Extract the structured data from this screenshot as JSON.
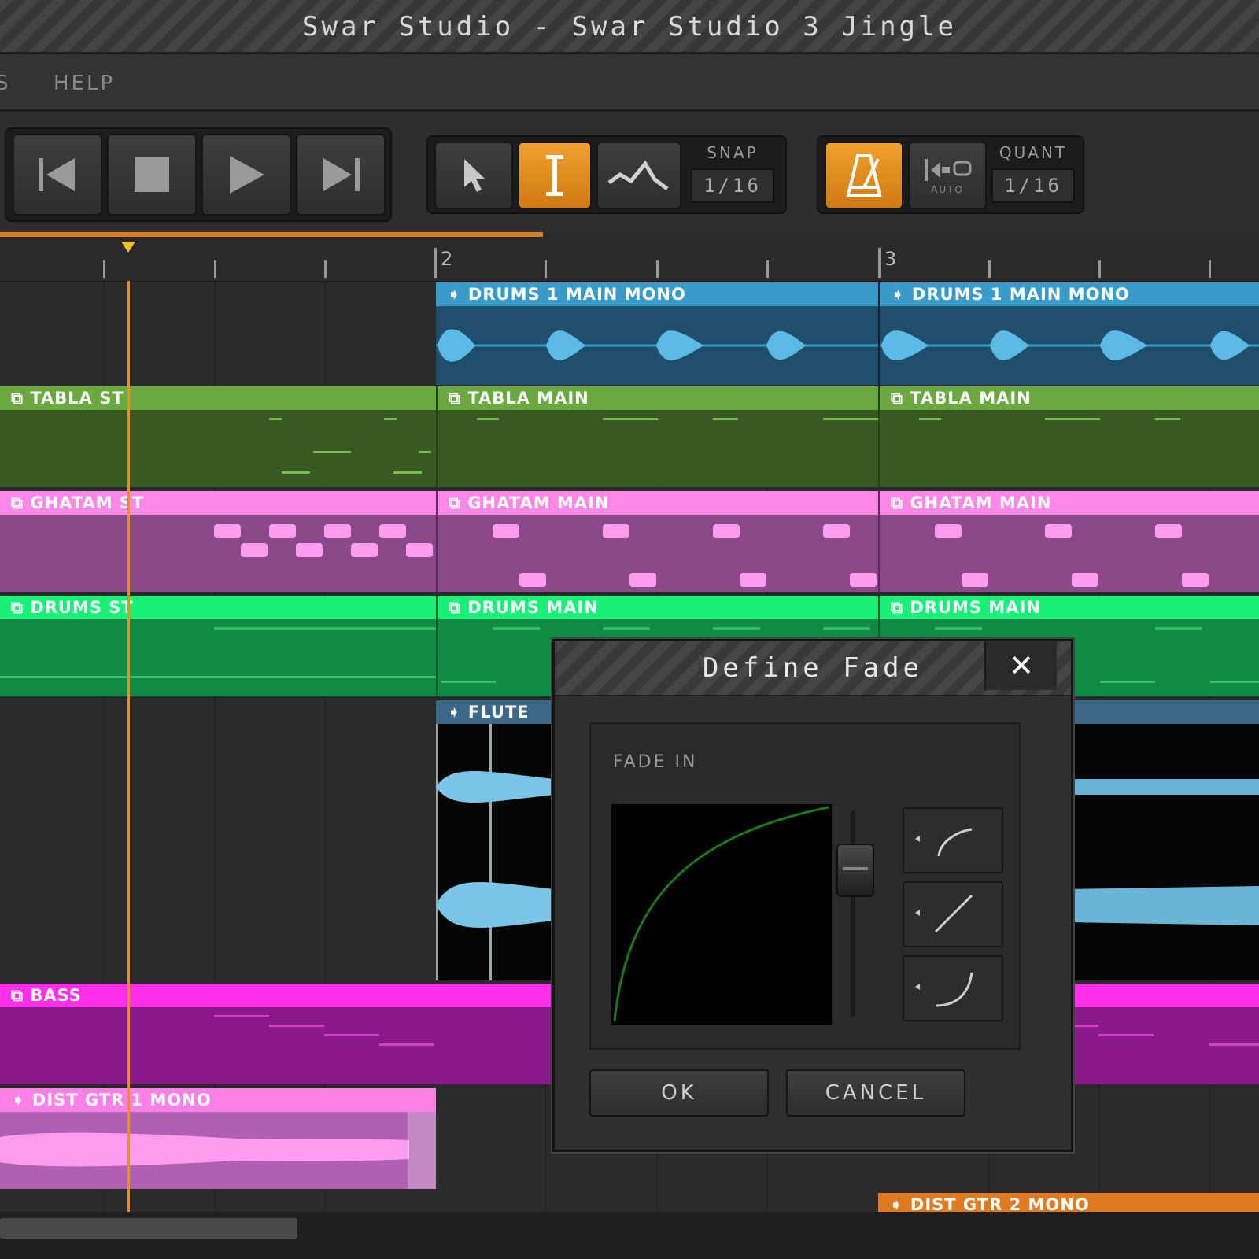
{
  "window": {
    "title": "Swar Studio - Swar Studio 3 Jingle"
  },
  "menu": {
    "partial": "S",
    "help": "HELP"
  },
  "transport": {
    "snap_label": "SNAP",
    "snap_value": "1/16",
    "quant_label": "QUANT",
    "quant_value": "1/16",
    "auto_label": "AUTO"
  },
  "ruler": {
    "bar2": "2",
    "bar3": "3"
  },
  "tracks": {
    "drums1_a": "DRUMS 1 MAIN MONO",
    "drums1_b": "DRUMS 1 MAIN MONO",
    "tabla_st": "TABLA ST",
    "tabla_main_a": "TABLA MAIN",
    "tabla_main_b": "TABLA MAIN",
    "ghatam_st": "GHATAM ST",
    "ghatam_main_a": "GHATAM MAIN",
    "ghatam_main_b": "GHATAM MAIN",
    "drums_st": "DRUMS ST",
    "drums_main_a": "DRUMS MAIN",
    "drums_main_b": "DRUMS MAIN",
    "flute": "FLUTE",
    "bass": "BASS",
    "dist_gtr1": "DIST GTR 1 MONO",
    "dist_gtr2": "DIST GTR 2 MONO"
  },
  "colors": {
    "accent": "#e89020",
    "drums1": "#3a9ac8",
    "tabla": "#6aa840",
    "ghatam": "#ff88e6",
    "drums": "#18f078",
    "bass": "#ff30e8",
    "distgtr1": "#ff80e8",
    "distgtr2": "#e07a20"
  },
  "dialog": {
    "title": "Define Fade",
    "close": "✕",
    "fade_label": "FADE IN",
    "ok": "OK",
    "cancel": "CANCEL"
  }
}
